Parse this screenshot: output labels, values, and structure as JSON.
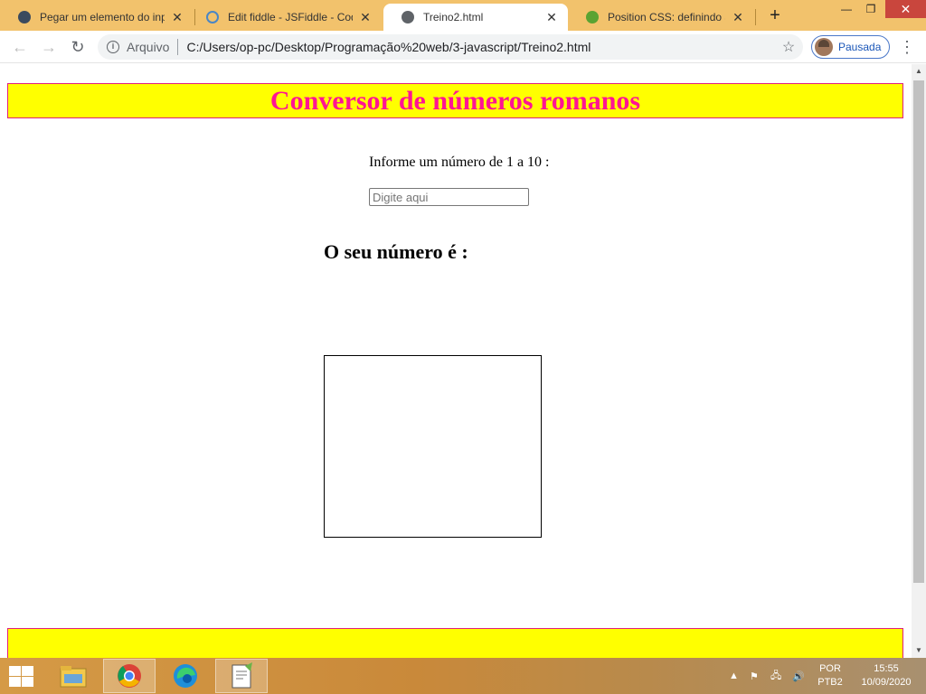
{
  "tabs": [
    {
      "title": "Pegar um elemento do inp",
      "active": false
    },
    {
      "title": "Edit fiddle - JSFiddle - Code",
      "active": false
    },
    {
      "title": "Treino2.html",
      "active": true
    },
    {
      "title": "Position CSS: definindo a p",
      "active": false
    }
  ],
  "address_bar": {
    "scheme_label": "Arquivo",
    "url": "C:/Users/op-pc/Desktop/Programação%20web/3-javascript/Treino2.html"
  },
  "profile": {
    "label": "Pausada"
  },
  "page": {
    "heading": "Conversor de números romanos",
    "prompt": "Informe um número de 1 a 10 :",
    "input_placeholder": "Digite aqui",
    "input_value": "",
    "result_label": "O seu número é :"
  },
  "taskbar": {
    "language": "POR",
    "layout": "PTB2",
    "time": "15:55",
    "date": "10/09/2020"
  },
  "colors": {
    "tabstrip": "#f2c26c",
    "banner_bg": "#ffff00",
    "banner_border": "#e0207c",
    "heading_text": "#ff1493"
  }
}
